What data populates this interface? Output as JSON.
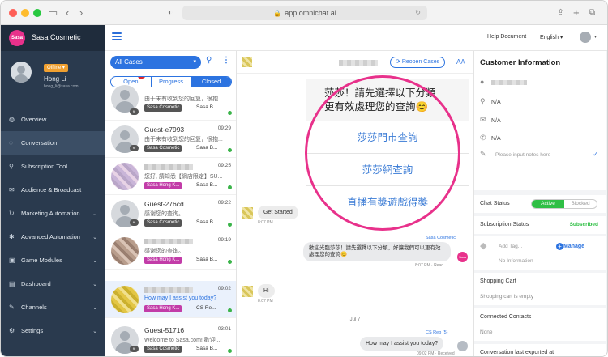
{
  "browser": {
    "url": "app.omnichat.ai"
  },
  "sidebar": {
    "brand_logo": "Sasa",
    "brand_name": "Sasa Cosmetic",
    "status": "Offline",
    "user_name": "Hong Li",
    "user_email": "hong_li@sasa.com",
    "items": [
      {
        "label": "Overview",
        "icon": "grid-icon"
      },
      {
        "label": "Conversation",
        "icon": "chat-icon"
      },
      {
        "label": "Subscription Tool",
        "icon": "tool-icon"
      },
      {
        "label": "Audience & Broadcast",
        "icon": "megaphone-icon"
      },
      {
        "label": "Marketing Automation",
        "icon": "automation-icon"
      },
      {
        "label": "Advanced Automation",
        "icon": "gear-icon"
      },
      {
        "label": "Game Modules",
        "icon": "gamepad-icon"
      },
      {
        "label": "Dashboard",
        "icon": "chart-icon"
      },
      {
        "label": "Channels",
        "icon": "wrench-icon"
      },
      {
        "label": "Settings",
        "icon": "settings-icon"
      }
    ]
  },
  "header": {
    "help": "Help Document",
    "language": "English"
  },
  "convlist": {
    "cases_select": "All Cases",
    "tabs": [
      "Open",
      "Progress",
      "Closed"
    ],
    "open_badge": "1",
    "items": [
      {
        "name": "",
        "time": "",
        "preview": "由于未有收到您的回复，很抱...",
        "tag": "Sasa Cosmetic",
        "tag_color": "gray",
        "assignee": "Sasa B..."
      },
      {
        "name": "Guest-e7993",
        "time": "09:29",
        "preview": "由于未有收到您的回复，很抱...",
        "tag": "Sasa Cosmetic",
        "tag_color": "gray",
        "assignee": "Sasa B..."
      },
      {
        "name": "",
        "time": "09:25",
        "preview": "您好, 請知悉【網店限定】SU...",
        "tag": "Sasa Hong K...",
        "tag_color": "pink",
        "assignee": "Sasa B..."
      },
      {
        "name": "Guest-276cd",
        "time": "09:22",
        "preview": "感谢您的查询。",
        "tag": "Sasa Cosmetic",
        "tag_color": "gray",
        "assignee": "Sasa B..."
      },
      {
        "name": "",
        "time": "09:19",
        "preview": "感谢您的查询。",
        "tag": "Sasa Hong K...",
        "tag_color": "pink",
        "assignee": "Sasa B..."
      },
      {
        "name": "",
        "time": "09:02",
        "preview": "How may I assist you today?",
        "tag": "Sasa Hong K...",
        "tag_color": "pink",
        "assignee": "CS Re..."
      },
      {
        "name": "Guest-51716",
        "time": "03:01",
        "preview": "Welcome to Sasa.com! 歡迎...",
        "tag": "Sasa Cosmetic",
        "tag_color": "gray",
        "assignee": "Sasa B..."
      }
    ]
  },
  "chat": {
    "reopen": "Reopen Cases",
    "font_toggle": "AA",
    "ig_header": "莎莎！請先選擇以下分類\n更有效處理您的查詢😊",
    "ig_options": [
      "莎莎門市查詢",
      "莎莎網查詢",
      "直播有獎遊戲得獎"
    ],
    "messages": [
      {
        "dir": "in",
        "text": "Get Started",
        "time": "8:07 PM"
      },
      {
        "dir": "out",
        "sender": "Sasa Cosmetic",
        "text": "歡迎光臨莎莎！請先選擇以下分類，好讓我們可以更有效處理您的查詢😊",
        "time": "8:07 PM · Read"
      },
      {
        "dir": "in",
        "text": "Hi",
        "time": "8:07 PM"
      },
      {
        "dir": "out",
        "sender": "CS Rep (5)",
        "text": "How may I assist you today?",
        "time": "09:02 PM · Received"
      }
    ],
    "date_sep": "Jul 7"
  },
  "info": {
    "title": "Customer Information",
    "phone": "N/A",
    "email": "N/A",
    "notes_placeholder": "Please input notes here",
    "chat_status_label": "Chat Status",
    "chat_status_on": "Active",
    "chat_status_off": "Blocked",
    "subscription_label": "Subscription Status",
    "subscription_value": "Subscribed",
    "add_tag": "Add Tag...",
    "manage": "Manage",
    "no_info": "No Information",
    "cart_label": "Shopping Cart",
    "cart_value": "Shopping cart is empty",
    "contacts_label": "Connected Contacts",
    "contacts_value": "None",
    "exported_label": "Conversation last exported at",
    "country": "N/A"
  }
}
